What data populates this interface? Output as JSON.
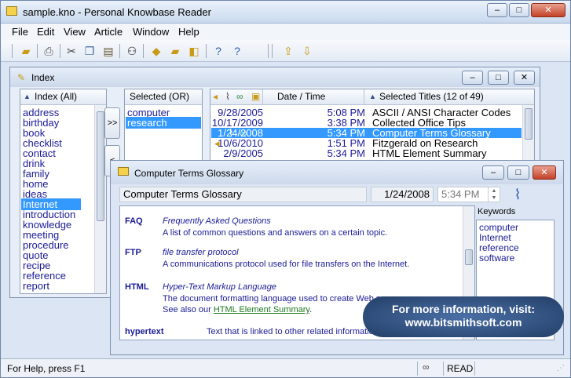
{
  "window": {
    "title": "sample.kno - Personal Knowbase Reader",
    "min": "–",
    "max": "□",
    "close": "✕"
  },
  "menu": [
    "File",
    "Edit",
    "View",
    "Article",
    "Window",
    "Help"
  ],
  "toolbar_icons": [
    "open-icon",
    "print-icon",
    "cut-icon",
    "copy-icon",
    "paste-icon",
    "find-icon",
    "filter-icon",
    "folders-icon",
    "index-icon",
    "help-icon",
    "context-help-icon",
    "export-icon",
    "import-icon"
  ],
  "index_panel": {
    "title": "Index",
    "index_header": "Index (All)",
    "keywords": [
      "address",
      "birthday",
      "book",
      "checklist",
      "contact",
      "drink",
      "family",
      "home",
      "ideas",
      "Internet",
      "introduction",
      "knowledge",
      "meeting",
      "procedure",
      "quote",
      "recipe",
      "reference",
      "report"
    ],
    "selected_keyword": "Internet",
    "selected_header": "Selected (OR)",
    "selected_items": [
      "computer",
      "research"
    ],
    "add_button": ">>",
    "remove_button": "<",
    "titles_header": "Selected Titles (12 of 49)",
    "date_header": "Date / Time",
    "rows": [
      {
        "date": "9/28/2005",
        "time": "5:08 PM",
        "title": "ASCII / ANSI Character Codes",
        "selected": false
      },
      {
        "date": "10/17/2009",
        "time": "3:38 PM",
        "title": "Collected Office Tips",
        "selected": false
      },
      {
        "date": "1/24/2008",
        "time": "5:34 PM",
        "title": "Computer Terms Glossary",
        "selected": true
      },
      {
        "date": "10/6/2010",
        "time": "1:51 PM",
        "title": "Fitzgerald on Research",
        "selected": false
      },
      {
        "date": "2/9/2005",
        "time": "5:34 PM",
        "title": "HTML Element Summary",
        "selected": false
      }
    ]
  },
  "article": {
    "title": "Computer Terms Glossary",
    "title_field": "Computer Terms Glossary",
    "date": "1/24/2008",
    "time": "5:34 PM",
    "keywords_label": "Keywords",
    "keywords": [
      "computer",
      "Internet",
      "reference",
      "software"
    ],
    "entries": [
      {
        "term": "FAQ",
        "definition": "Frequently Asked Questions",
        "text": "A list of common questions and answers on a certain topic."
      },
      {
        "term": "FTP",
        "definition": "file transfer protocol",
        "text": "A communications protocol used for file transfers on the Internet."
      },
      {
        "term": "HTML",
        "definition": "Hyper-Text Markup Language",
        "text": "The document formatting language used to create Web pages.",
        "see_also_prefix": "See also our ",
        "see_also_link": "HTML Element Summary",
        "see_also_suffix": "."
      },
      {
        "term": "hypertext",
        "definition": "",
        "text": "Text that is linked to other related information."
      }
    ]
  },
  "promo": {
    "line1": "For more information, visit:",
    "line2": "www.bitsmithsoft.com"
  },
  "status": {
    "help_text": "For Help, press F1",
    "mode": "READ"
  },
  "colors": {
    "selection": "#3399ff",
    "link": "#1a1a96"
  }
}
